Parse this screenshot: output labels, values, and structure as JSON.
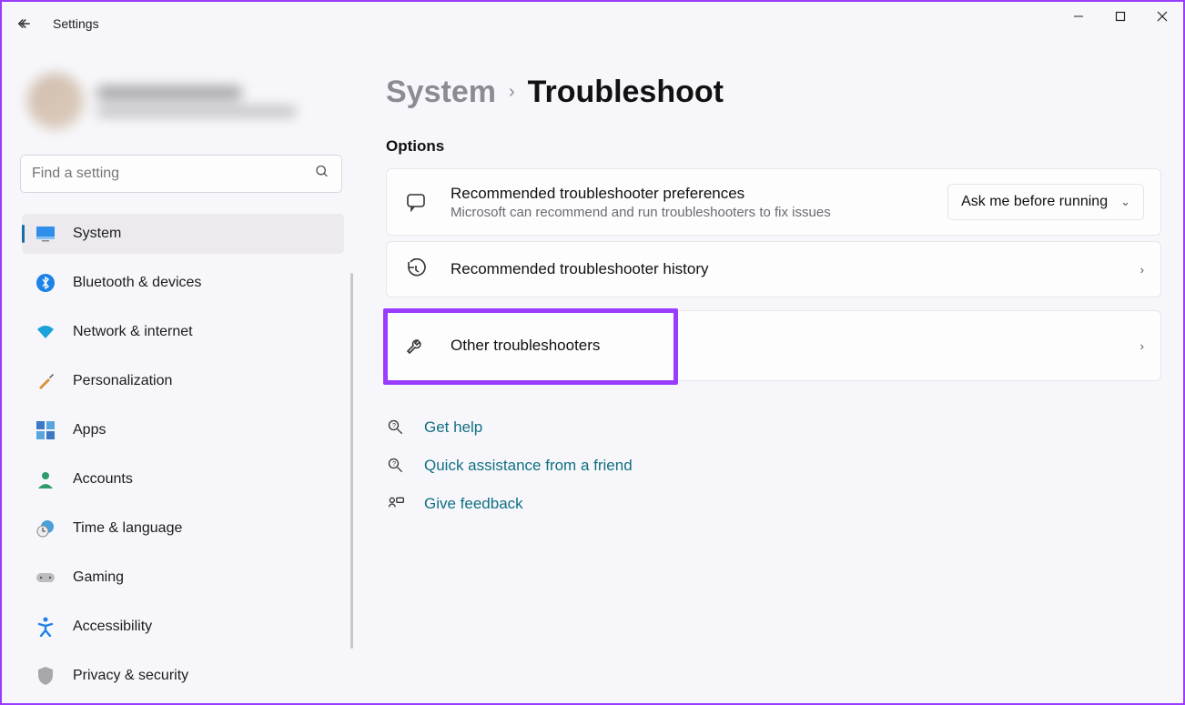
{
  "window": {
    "title": "Settings"
  },
  "search": {
    "placeholder": "Find a setting"
  },
  "nav": {
    "items": [
      {
        "label": "System"
      },
      {
        "label": "Bluetooth & devices"
      },
      {
        "label": "Network & internet"
      },
      {
        "label": "Personalization"
      },
      {
        "label": "Apps"
      },
      {
        "label": "Accounts"
      },
      {
        "label": "Time & language"
      },
      {
        "label": "Gaming"
      },
      {
        "label": "Accessibility"
      },
      {
        "label": "Privacy & security"
      }
    ]
  },
  "breadcrumb": {
    "parent": "System",
    "current": "Troubleshoot"
  },
  "section": {
    "title": "Options"
  },
  "cards": {
    "pref": {
      "title": "Recommended troubleshooter preferences",
      "sub": "Microsoft can recommend and run troubleshooters to fix issues",
      "dropdown": "Ask me before running"
    },
    "history": {
      "title": "Recommended troubleshooter history"
    },
    "other": {
      "title": "Other troubleshooters"
    }
  },
  "help": {
    "gethelp": "Get help",
    "quick": "Quick assistance from a friend",
    "feedback": "Give feedback"
  }
}
